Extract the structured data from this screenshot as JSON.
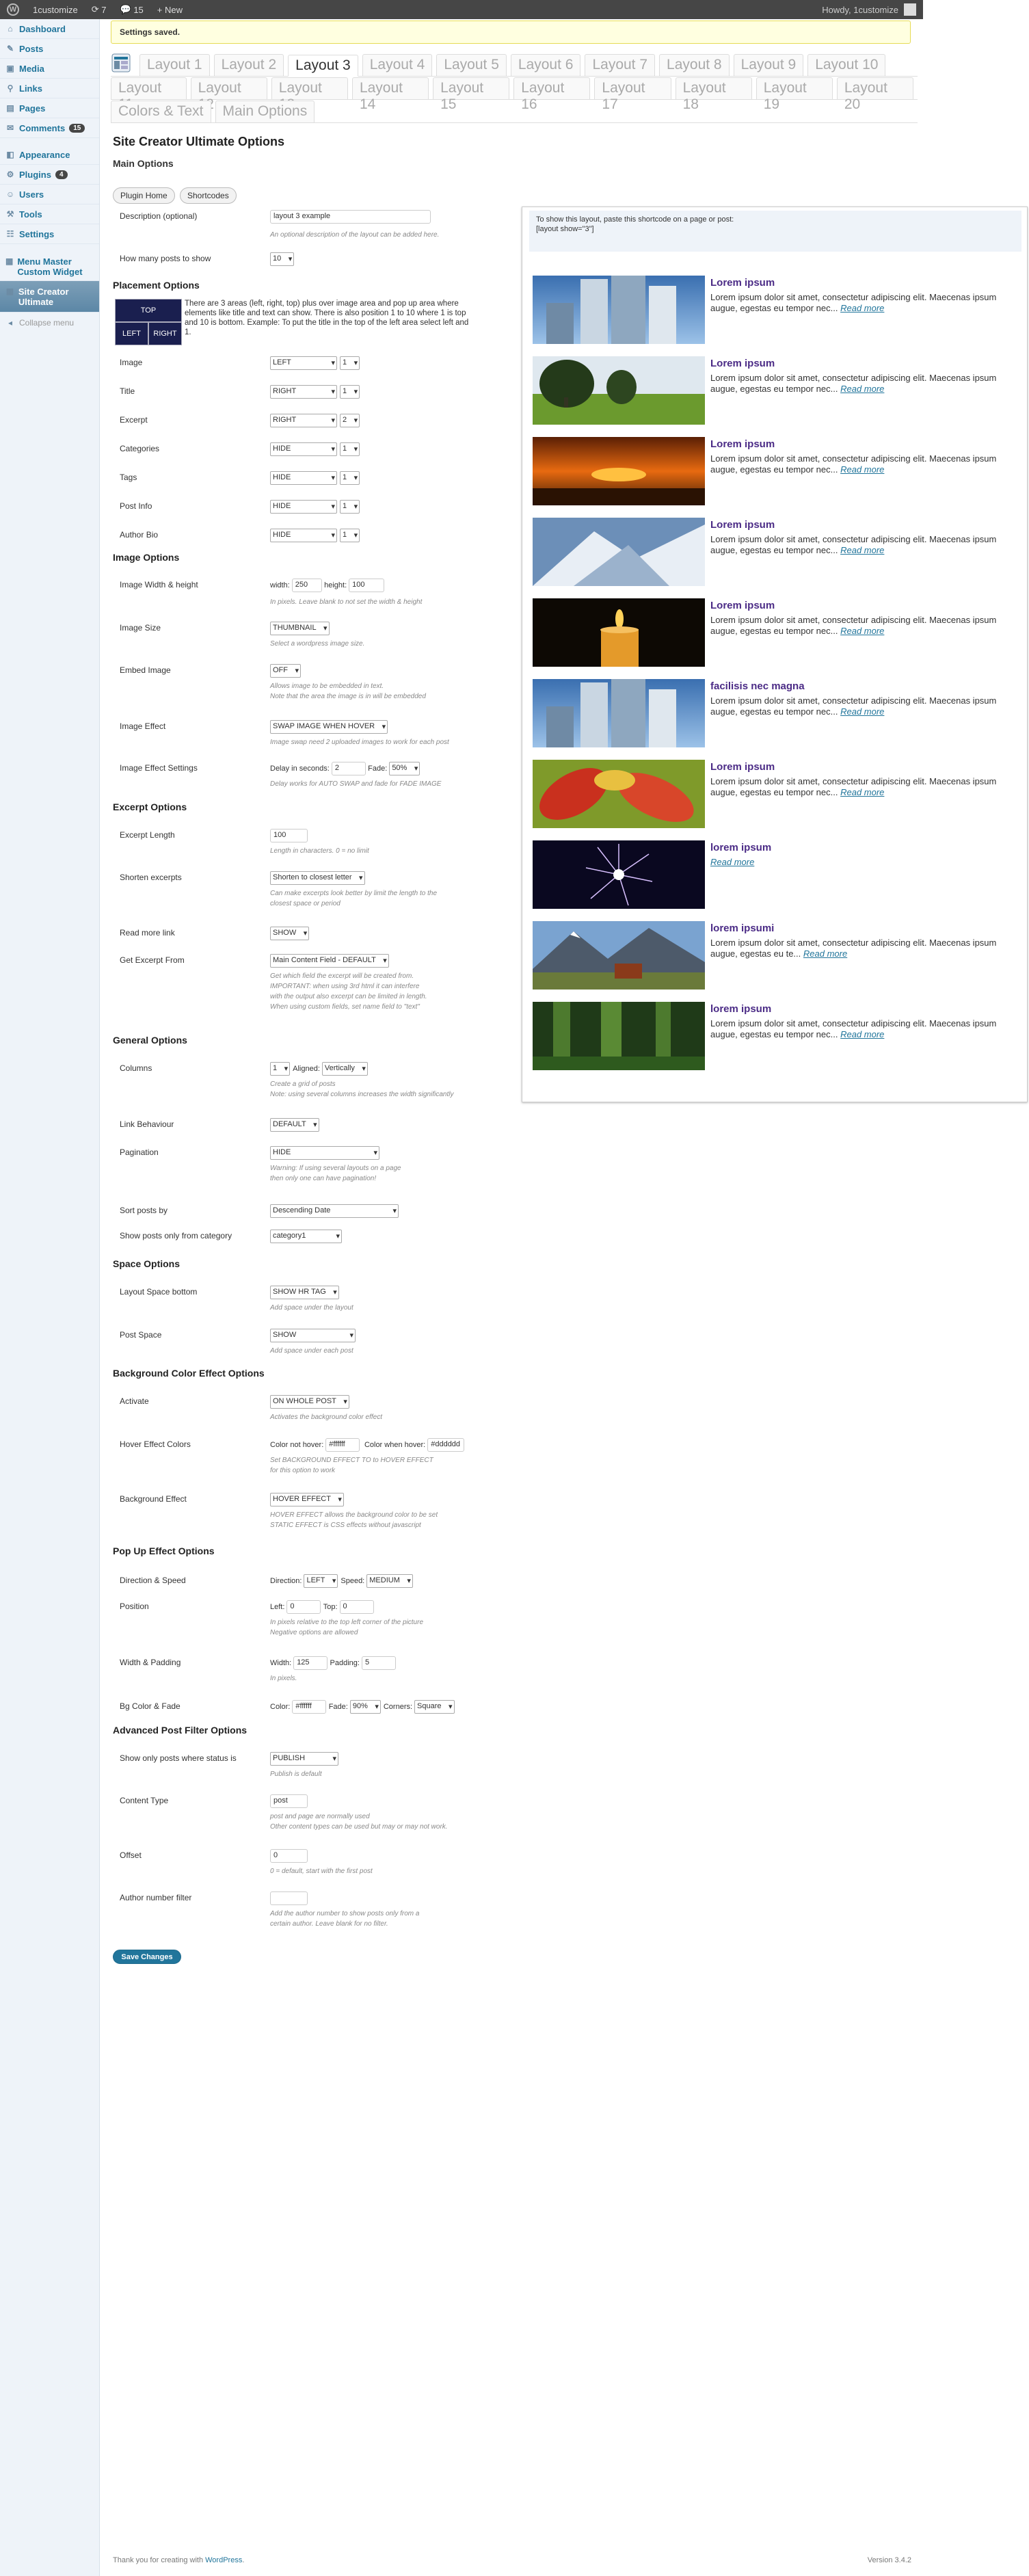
{
  "adminbar": {
    "site": "1customize",
    "updates": "7",
    "comments": "15",
    "new": "New",
    "howdy": "Howdy, 1customize"
  },
  "menu": [
    {
      "label": "Dashboard",
      "icon": "dashboard-icon",
      "glyph": "⌂"
    },
    {
      "label": "Posts",
      "icon": "posts-icon",
      "glyph": "✎"
    },
    {
      "label": "Media",
      "icon": "media-icon",
      "glyph": "▣"
    },
    {
      "label": "Links",
      "icon": "links-icon",
      "glyph": "⚲"
    },
    {
      "label": "Pages",
      "icon": "pages-icon",
      "glyph": "▤"
    },
    {
      "label": "Comments",
      "icon": "comments-icon",
      "glyph": "✉",
      "badge": "15"
    },
    {
      "label": "Appearance",
      "icon": "appearance-icon",
      "glyph": "◧"
    },
    {
      "label": "Plugins",
      "icon": "plugins-icon",
      "glyph": "⚙",
      "badge": "4"
    },
    {
      "label": "Users",
      "icon": "users-icon",
      "glyph": "☺"
    },
    {
      "label": "Tools",
      "icon": "tools-icon",
      "glyph": "⚒"
    },
    {
      "label": "Settings",
      "icon": "settings-icon",
      "glyph": "☷"
    },
    {
      "label": "Menu Master Custom Widget",
      "icon": "menu-master-icon",
      "glyph": "▦"
    },
    {
      "label": "Site Creator Ultimate",
      "icon": "site-creator-icon",
      "glyph": "▦"
    },
    {
      "label": "Collapse menu",
      "icon": "collapse-icon",
      "glyph": "◂"
    }
  ],
  "notice": "Settings saved.",
  "tabs_row1": [
    "Layout 1",
    "Layout 2",
    "Layout 3",
    "Layout 4",
    "Layout 5",
    "Layout 6",
    "Layout 7",
    "Layout 8",
    "Layout 9",
    "Layout 10"
  ],
  "tabs_row2": [
    "Layout 11",
    "Layout 12",
    "Layout 13",
    "Layout 14",
    "Layout 15",
    "Layout 16",
    "Layout 17",
    "Layout 18",
    "Layout 19",
    "Layout 20"
  ],
  "tabs_row3": [
    "Colors & Text",
    "Main Options"
  ],
  "title": "Site Creator Ultimate Options",
  "main_options": "Main Options",
  "plugin_home": "Plugin Home",
  "shortcodes": "Shortcodes",
  "description": {
    "label": "Description (optional)",
    "value": "layout 3 example",
    "hint": "An optional description of the layout can be added here."
  },
  "posts_to_show": {
    "label": "How many posts to show",
    "value": "10"
  },
  "placement": {
    "title": "Placement Options",
    "top": "TOP",
    "left": "LEFT",
    "right": "RIGHT",
    "text": "There are 3 areas (left, right, top) plus over image area and pop up area where elements like title and text can show. There is also position 1 to 10 where 1 is top and 10 is bottom. Example: To put the title in the top of the left area select left and 1.",
    "rows": [
      {
        "label": "Image",
        "area": "LEFT",
        "pos": "1"
      },
      {
        "label": "Title",
        "area": "RIGHT",
        "pos": "1"
      },
      {
        "label": "Excerpt",
        "area": "RIGHT",
        "pos": "2"
      },
      {
        "label": "Categories",
        "area": "HIDE",
        "pos": "1"
      },
      {
        "label": "Tags",
        "area": "HIDE",
        "pos": "1"
      },
      {
        "label": "Post Info",
        "area": "HIDE",
        "pos": "1"
      },
      {
        "label": "Author Bio",
        "area": "HIDE",
        "pos": "1"
      }
    ]
  },
  "image_options": {
    "title": "Image Options",
    "wh": {
      "label": "Image Width & height",
      "width_l": "width:",
      "width": "250",
      "height_l": "height:",
      "height": "100",
      "hint": "In pixels. Leave blank to not set the width & height"
    },
    "size": {
      "label": "Image Size",
      "value": "THUMBNAIL",
      "hint": "Select a wordpress image size."
    },
    "embed": {
      "label": "Embed Image",
      "value": "OFF",
      "hint1": "Allows image to be embedded in text.",
      "hint2": "Note that the area the image is in will be embedded"
    },
    "effect": {
      "label": "Image Effect",
      "value": "SWAP IMAGE WHEN HOVER",
      "hint": "Image swap need 2 uploaded images to work for each post"
    },
    "settings": {
      "label": "Image Effect Settings",
      "delay_l": "Delay in seconds:",
      "delay": "2",
      "fade_l": "Fade:",
      "fade": "50%",
      "hint": "Delay works for AUTO SWAP and fade for FADE IMAGE"
    }
  },
  "excerpt_options": {
    "title": "Excerpt Options",
    "length": {
      "label": "Excerpt Length",
      "value": "100",
      "hint": "Length in characters. 0 = no limit"
    },
    "shorten": {
      "label": "Shorten excerpts",
      "value": "Shorten to closest letter",
      "hint1": "Can make excerpts look better by limit the length to the",
      "hint2": "closest space or period"
    },
    "readmore": {
      "label": "Read more link",
      "value": "SHOW"
    },
    "from": {
      "label": "Get Excerpt From",
      "value": "Main Content Field - DEFAULT",
      "hint1": "Get which field the excerpt will be created from.",
      "hint2": "IMPORTANT: when using 3rd html it can interfere",
      "hint3": "with the output also excerpt can be limited in length.",
      "hint4": "When using custom fields, set name field to \"text\""
    }
  },
  "general_options": {
    "title": "General Options",
    "columns": {
      "label": "Columns",
      "value": "1",
      "aligned_l": "Aligned:",
      "aligned": "Vertically",
      "hint1": "Create a grid of posts",
      "hint2": "Note: using several columns increases the width significantly"
    },
    "link": {
      "label": "Link Behaviour",
      "value": "DEFAULT"
    },
    "pagination": {
      "label": "Pagination",
      "value": "HIDE",
      "hint1": "Warning: If using several layouts on a page",
      "hint2": "then only one can have pagination!"
    },
    "sort": {
      "label": "Sort posts by",
      "value": "Descending Date"
    },
    "category": {
      "label": "Show posts only from category",
      "value": "category1"
    }
  },
  "space_options": {
    "title": "Space Options",
    "bottom": {
      "label": "Layout Space bottom",
      "value": "SHOW HR TAG",
      "hint": "Add space under the layout"
    },
    "post": {
      "label": "Post Space",
      "value": "SHOW",
      "hint": "Add space under each post"
    }
  },
  "bg_options": {
    "title": "Background Color Effect Options",
    "activate": {
      "label": "Activate",
      "value": "ON WHOLE POST",
      "hint": "Activates the background color effect"
    },
    "colors": {
      "label": "Hover Effect Colors",
      "nh_l": "Color not hover:",
      "nh": "#ffffff",
      "h_l": "Color when hover:",
      "h": "#dddddd",
      "hint1": "Set BACKGROUND EFFECT TO to HOVER EFFECT",
      "hint2": "for this option to work"
    },
    "effect": {
      "label": "Background Effect",
      "value": "HOVER EFFECT",
      "hint1": "HOVER EFFECT allows the background color to be set",
      "hint2": "STATIC EFFECT is CSS effects without javascript"
    }
  },
  "popup_options": {
    "title": "Pop Up Effect Options",
    "dir": {
      "label": "Direction & Speed",
      "dir_l": "Direction:",
      "dir": "LEFT",
      "speed_l": "Speed:",
      "speed": "MEDIUM"
    },
    "pos": {
      "label": "Position",
      "left_l": "Left:",
      "left": "0",
      "top_l": "Top:",
      "top": "0",
      "hint1": "In pixels relative to the top left corner of the picture",
      "hint2": "Negative options are allowed"
    },
    "wp": {
      "label": "Width & Padding",
      "w_l": "Width:",
      "w": "125",
      "p_l": "Padding:",
      "p": "5",
      "hint": "In pixels."
    },
    "bg": {
      "label": "Bg Color & Fade",
      "c_l": "Color:",
      "c": "#ffffff",
      "f_l": "Fade:",
      "f": "90%",
      "corner_l": "Corners:",
      "corner": "Square"
    }
  },
  "filter_options": {
    "title": "Advanced Post Filter Options",
    "status": {
      "label": "Show only posts where status is",
      "value": "PUBLISH",
      "hint": "Publish is default"
    },
    "ctype": {
      "label": "Content Type",
      "value": "post",
      "hint1": "post and page are normally used",
      "hint2": "Other content types can be used but may or may not work."
    },
    "offset": {
      "label": "Offset",
      "value": "0",
      "hint": "0 = default, start with the first post"
    },
    "author": {
      "label": "Author number filter",
      "value": "",
      "hint1": "Add the author number to show posts only from a",
      "hint2": "certain author. Leave blank for no filter."
    }
  },
  "save": "Save Changes",
  "preview": {
    "shortcode1": "To show this layout, paste this shortcode on a page or post:",
    "shortcode2": "[layout show=\"3\"]",
    "posts": [
      {
        "title": "Lorem ipsum",
        "excerpt": "Lorem ipsum dolor sit amet, consectetur adipiscing elit. Maecenas ipsum augue, egestas eu tempor nec...",
        "more": "Read more",
        "img": "buildings"
      },
      {
        "title": "Lorem ipsum",
        "excerpt": "Lorem ipsum dolor sit amet, consectetur adipiscing elit. Maecenas ipsum augue, egestas eu tempor nec...",
        "more": "Read more",
        "img": "field"
      },
      {
        "title": "Lorem ipsum",
        "excerpt": "Lorem ipsum dolor sit amet, consectetur adipiscing elit. Maecenas ipsum augue, egestas eu tempor nec...",
        "more": "Read more",
        "img": "sunset"
      },
      {
        "title": "Lorem ipsum",
        "excerpt": "Lorem ipsum dolor sit amet, consectetur adipiscing elit. Maecenas ipsum augue, egestas eu tempor nec...",
        "more": "Read more",
        "img": "snow"
      },
      {
        "title": "Lorem ipsum",
        "excerpt": "Lorem ipsum dolor sit amet, consectetur adipiscing elit. Maecenas ipsum augue, egestas eu tempor nec...",
        "more": "Read more",
        "img": "candle"
      },
      {
        "title": "facilisis nec magna",
        "excerpt": "Lorem ipsum dolor sit amet, consectetur adipiscing elit. Maecenas ipsum augue, egestas eu tempor nec...",
        "more": "Read more",
        "img": "buildings"
      },
      {
        "title": "Lorem ipsum",
        "excerpt": "Lorem ipsum dolor sit amet, consectetur adipiscing elit. Maecenas ipsum augue, egestas eu tempor nec...",
        "more": "Read more",
        "img": "leaves"
      },
      {
        "title": "lorem ipsum",
        "excerpt": "",
        "more": "Read more",
        "img": "fireworks"
      },
      {
        "title": "lorem ipsumi",
        "excerpt": "Lorem ipsum dolor sit amet, consectetur adipiscing elit. Maecenas ipsum augue, egestas eu te...",
        "more": "Read more",
        "img": "mountain"
      },
      {
        "title": "lorem ipsum",
        "excerpt": "Lorem ipsum dolor sit amet, consectetur adipiscing elit. Maecenas ipsum augue, egestas eu tempor nec...",
        "more": "Read more",
        "img": "forest"
      }
    ]
  },
  "footer": {
    "thanks": "Thank you for creating with ",
    "wp": "WordPress",
    "version": "Version 3.4.2"
  }
}
